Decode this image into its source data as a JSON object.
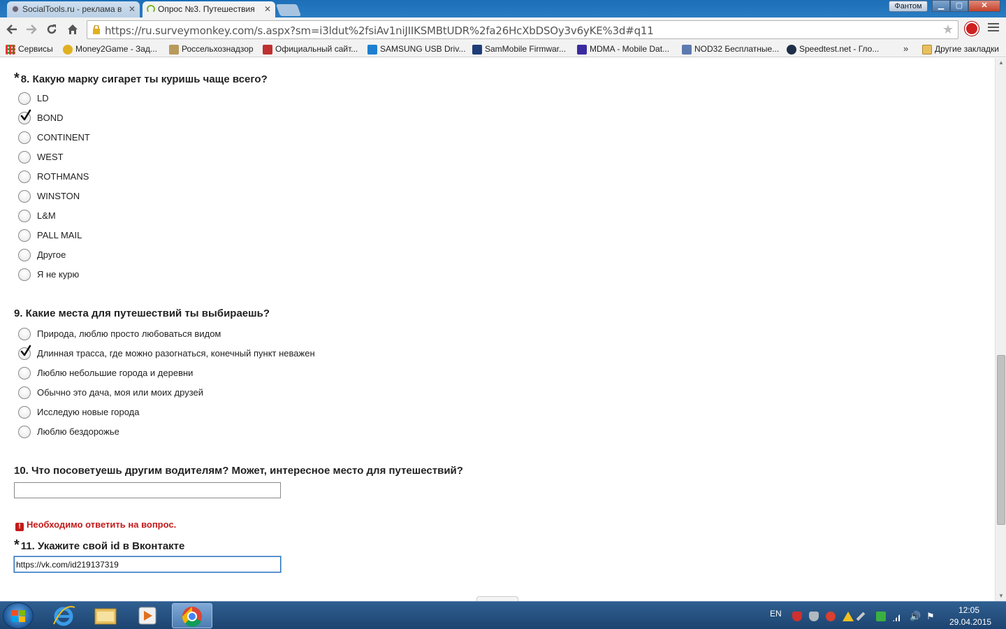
{
  "browser": {
    "tabs": [
      {
        "title": "SocialTools.ru - реклама в",
        "active": false
      },
      {
        "title": "Опрос №3. Путешествия",
        "active": true
      }
    ],
    "profile_label": "Фантом",
    "url": "https://ru.surveymonkey.com/s.aspx?sm=i3ldut%2fsiAv1niJIIKSMBtUDR%2fa26HcXbDSOy3v6yKE%3d#q11",
    "bookmarks": [
      "Сервисы",
      "Money2Game - Зад...",
      "Россельхознадзор",
      "Официальный сайт...",
      "SAMSUNG USB Driv...",
      "SamMobile Firmwar...",
      "MDMA - Mobile Dat...",
      "NOD32 Бесплатные...",
      "Speedtest.net - Гло..."
    ],
    "bookmarks_more": "»",
    "other_bookmarks": "Другие закладки"
  },
  "survey": {
    "q8": {
      "required_mark": "*",
      "title": "8. Какую марку сигарет ты куришь чаще всего?",
      "options": [
        "LD",
        "BOND",
        "CONTINENT",
        "WEST",
        "ROTHMANS",
        "WINSTON",
        "L&M",
        "PALL MAIL",
        "Другое",
        "Я не курю"
      ],
      "selected": "BOND"
    },
    "q9": {
      "title": "9. Какие места для путешествий ты выбираешь?",
      "options": [
        "Природа, люблю просто любоваться видом",
        "Длинная трасса, где можно разогнаться, конечный пункт неважен",
        "Люблю небольшие города и деревни",
        "Обычно это дача, моя или моих друзей",
        "Исследую новые города",
        "Люблю бездорожье"
      ],
      "selected": "Длинная трасса, где можно разогнаться, конечный пункт неважен"
    },
    "q10": {
      "title": "10. Что посоветуешь другим водителям? Может, интересное место для путешествий?",
      "value": ""
    },
    "q11": {
      "error": "Необходимо ответить на вопрос.",
      "error_icon": "!",
      "required_mark": "*",
      "title": "11. Укажите свой id в Вконтакте",
      "value": "https://vk.com/id219137319"
    }
  },
  "taskbar": {
    "language": "EN",
    "time": "12:05",
    "date": "29.04.2015"
  },
  "colors": {
    "error": "#c41a1a",
    "titlebar": "#1c6fb8"
  }
}
